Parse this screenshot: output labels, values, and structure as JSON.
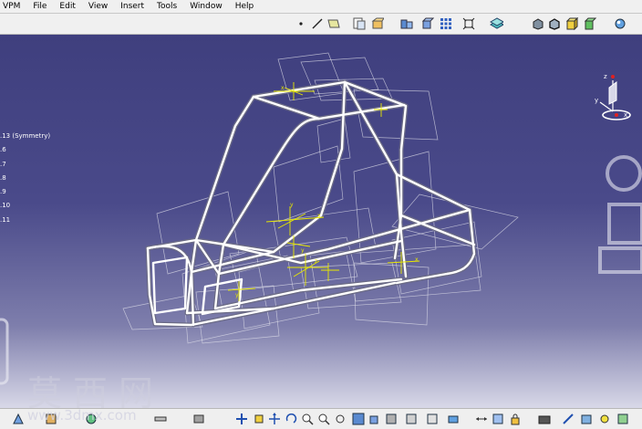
{
  "menubar": {
    "items": [
      "VPM",
      "File",
      "Edit",
      "View",
      "Insert",
      "Tools",
      "Window",
      "Help"
    ]
  },
  "toolbar": {
    "icons": [
      "point-icon",
      "line-icon",
      "plane-icon",
      "paste-special-icon",
      "hybrid-shape-icon",
      "grid-icon",
      "fit-icon",
      "material-icon",
      "shading-icon",
      "shading-edges-icon",
      "box-icon",
      "wireframe-icon",
      "render-icon"
    ]
  },
  "tree": {
    "items": [
      ".13 (Symmetry)",
      ".6",
      ".7",
      ".8",
      ".9",
      ".10",
      ".11"
    ]
  },
  "watermark": {
    "text": "莫西网",
    "url": "www.3dmx.com"
  },
  "compass": {
    "axis_x": "x",
    "axis_y": "y",
    "axis_z": "z"
  },
  "colors": {
    "viewport_top": "#3f3f7e",
    "viewport_bottom": "#d8d8e8",
    "frame": "#ffffff",
    "annotation": "#f0f000"
  }
}
